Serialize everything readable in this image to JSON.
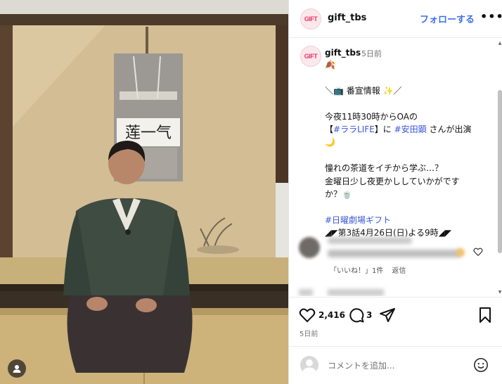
{
  "post": {
    "username": "gift_tbs",
    "follow_label": "フォローする",
    "more_label": "•••",
    "avatar_text": "GIFT",
    "time_ago": "5日前",
    "caption_lines": {
      "l1": "＼📺 番宣情報 ✨／",
      "l2": "今夜11時30時からOAの",
      "l3_pre": "【",
      "l3_tag": "#ララLIFE",
      "l3_mid": "】に ",
      "l3_tag2": "#安田顕",
      "l3_post": " さんが出演",
      "l4": "🌙",
      "l5": "憧れの茶道をイチから学ぶ…？",
      "l6": "金曜日少し夜更かししていかがです",
      "l7": "か？🍵",
      "l8_tag": "#日曜劇場ギフト",
      "l9": "◢◤第3話4月26日(日)よる9時◢◤"
    }
  },
  "comment": {
    "likes_label": "「いいね！」1件",
    "reply_label": "返信"
  },
  "actions": {
    "likes_count": "2,416",
    "comments_count": "3",
    "date": "5日前"
  },
  "comment_input": {
    "placeholder": "コメントを追加..."
  },
  "scroll": {
    "up": "▲",
    "down": "▼"
  },
  "icons": [
    "heart-icon",
    "comment-icon",
    "share-icon",
    "bookmark-icon",
    "emoji-icon",
    "user-tag-icon"
  ]
}
